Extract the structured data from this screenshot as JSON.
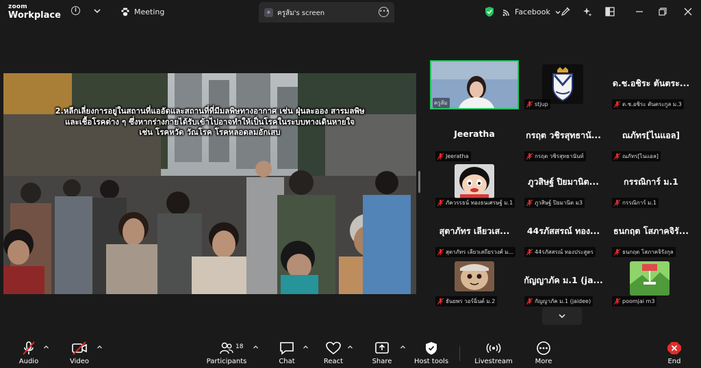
{
  "app": {
    "brand_top": "zoom",
    "brand_bottom": "Workplace"
  },
  "titlebar": {
    "meeting_label": "Meeting",
    "share_tab_label": "ครูส้ม's screen",
    "share_tab_avatar": "ค",
    "network_label": "Facebook"
  },
  "stage": {
    "caption_lines": [
      "2.หลีกเลี่ยงการอยู่ในสถานที่แออัดและสถานที่ที่มีมลพิษทางอากาศ เช่น ฝุ่นละออง สารมลพิษ",
      "และเชื้อโรคต่าง ๆ ซึ่งหากร่างกายได้รับเข้าไปอาจทำให้เป็นโรคในระบบทางเดินหายใจ",
      "เช่น โรคหวัด วัณโรค โรคหลอดลมอักเสบ"
    ]
  },
  "gallery": {
    "tiles": [
      {
        "kind": "video",
        "label": "ครูส้ม",
        "active": true
      },
      {
        "kind": "image",
        "image": "school-crest",
        "label": "stjup"
      },
      {
        "kind": "name",
        "name": "ด.ช.อชิระ ตันตระ...",
        "label": "ด.ช.อชิระ ตันตระกูล ม.3"
      },
      {
        "kind": "name",
        "name": "Jeeratha",
        "label": "Jeeratha"
      },
      {
        "kind": "name",
        "name": "กรฤต วชิรสุทธานั...",
        "label": "กรฤต วชิรสุทธานันท์"
      },
      {
        "kind": "name",
        "name": "ณภัทร[ไนแอล]",
        "label": "ณภัทร[ไนแอล]"
      },
      {
        "kind": "image",
        "image": "cartoon-boy",
        "label": "ภัควรรธน์ ทองธนเศรษฐ์ ม.1"
      },
      {
        "kind": "name",
        "name": "ภูวสิษฐ์ ปิยมานิต...",
        "label": "ภูวสิษฐ์ ปิยมานิต ม3"
      },
      {
        "kind": "name",
        "name": "กรรณิการ์ ม.1",
        "label": "กรรณิการ์ ม.1"
      },
      {
        "kind": "name",
        "name": "สุตาภัทร เลียวเส...",
        "label": "สุตาภัทร เลียวเสถียรวงศ์ ม..."
      },
      {
        "kind": "name",
        "name": "44รภัสสรณ์ ทอง...",
        "label": "44รภัสสรณ์ ทองประสูตร"
      },
      {
        "kind": "name",
        "name": "ธนกฤต โสภาคจิรั...",
        "label": "ธนกฤต โสภาคจิรังกุล"
      },
      {
        "kind": "image",
        "image": "cartoon-character",
        "label": "ธันยพร วอร์ฉิ่นต์ ม.2"
      },
      {
        "kind": "name",
        "name": "กัญญาภัค ม.1 (ja...",
        "label": "กัญญาภัค ม.1 (jaidee)"
      },
      {
        "kind": "image",
        "image": "mountain-art",
        "label": "poomjai m3"
      }
    ]
  },
  "toolbar": {
    "audio": "Audio",
    "video": "Video",
    "participants": "Participants",
    "participants_count": "18",
    "chat": "Chat",
    "react": "React",
    "share": "Share",
    "host_tools": "Host tools",
    "livestream": "Livestream",
    "more": "More",
    "end": "End"
  },
  "colors": {
    "active_speaker": "#22c55e",
    "muted": "#e02d2d",
    "end": "#e02d2d",
    "shield": "#22c55e"
  }
}
